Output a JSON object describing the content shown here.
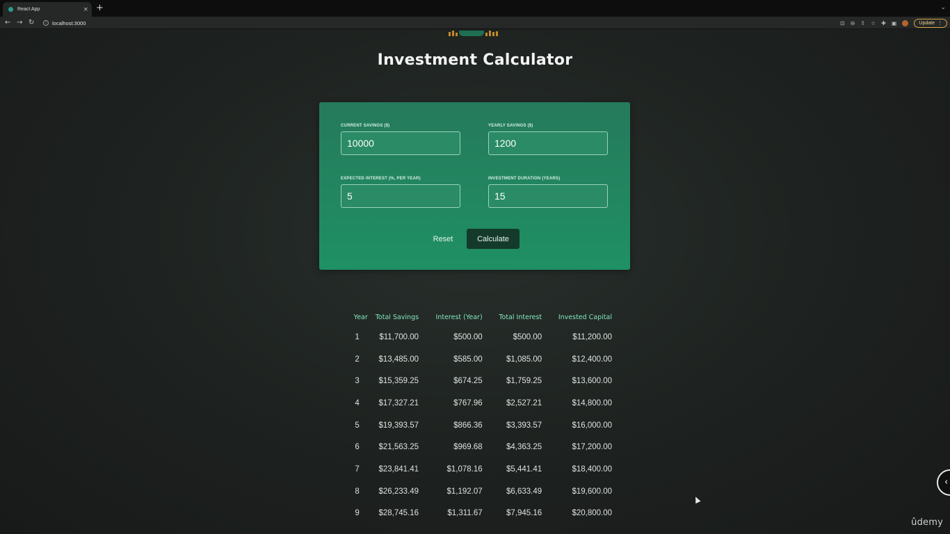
{
  "browser": {
    "tab_title": "React App",
    "tab_close": "×",
    "new_tab": "+",
    "url": "localhost:3000",
    "update_label": "Update",
    "back": "←",
    "forward": "→",
    "reload": "↻"
  },
  "app": {
    "title": "Investment Calculator"
  },
  "form": {
    "current_savings_label": "CURRENT SAVINGS ($)",
    "current_savings_value": "10000",
    "yearly_savings_label": "YEARLY SAVINGS ($)",
    "yearly_savings_value": "1200",
    "expected_interest_label": "EXPECTED INTEREST (%, PER YEAR)",
    "expected_interest_value": "5",
    "duration_label": "INVESTMENT DURATION (YEARS)",
    "duration_value": "15",
    "reset_label": "Reset",
    "calculate_label": "Calculate"
  },
  "table": {
    "headers": [
      "Year",
      "Total Savings",
      "Interest (Year)",
      "Total Interest",
      "Invested Capital"
    ],
    "rows": [
      [
        "1",
        "$11,700.00",
        "$500.00",
        "$500.00",
        "$11,200.00"
      ],
      [
        "2",
        "$13,485.00",
        "$585.00",
        "$1,085.00",
        "$12,400.00"
      ],
      [
        "3",
        "$15,359.25",
        "$674.25",
        "$1,759.25",
        "$13,600.00"
      ],
      [
        "4",
        "$17,327.21",
        "$767.96",
        "$2,527.21",
        "$14,800.00"
      ],
      [
        "5",
        "$19,393.57",
        "$866.36",
        "$3,393.57",
        "$16,000.00"
      ],
      [
        "6",
        "$21,563.25",
        "$969.68",
        "$4,363.25",
        "$17,200.00"
      ],
      [
        "7",
        "$23,841.41",
        "$1,078.16",
        "$5,441.41",
        "$18,400.00"
      ],
      [
        "8",
        "$26,233.49",
        "$1,192.07",
        "$6,633.49",
        "$19,600.00"
      ],
      [
        "9",
        "$28,745.16",
        "$1,311.67",
        "$7,945.16",
        "$20,800.00"
      ]
    ]
  },
  "watermark": "ûdemy",
  "colors": {
    "page_bg": "#1d211f",
    "card_top": "#257a5c",
    "card_bottom": "#1f9064",
    "header_text": "#83e6bd",
    "calculate_bg": "#143a2c",
    "update_accent": "#d9a441"
  }
}
